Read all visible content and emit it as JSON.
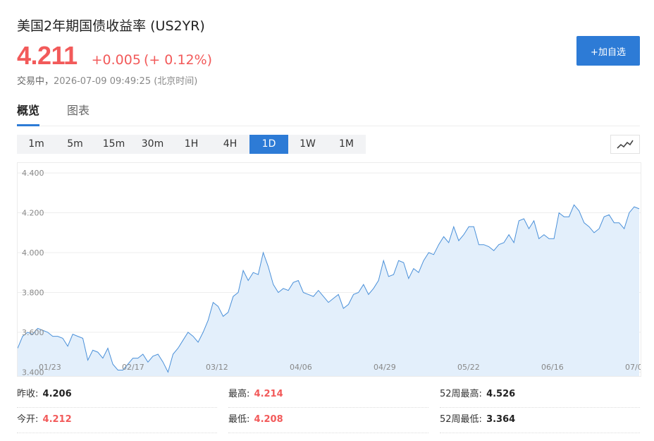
{
  "header": {
    "title": "美国2年期国债收益率",
    "code": "(US2YR)",
    "price": "4.211",
    "change": "+0.005",
    "change_pct": "(+ 0.12%)",
    "status": "交易中，",
    "timestamp": "2026-07-09 09:49:25 (北京时间)",
    "add_watchlist_label": "+加自选"
  },
  "tabs": [
    {
      "label": "概览",
      "active": true
    },
    {
      "label": "图表",
      "active": false
    }
  ],
  "ranges": [
    {
      "label": "1m",
      "active": false
    },
    {
      "label": "5m",
      "active": false
    },
    {
      "label": "15m",
      "active": false
    },
    {
      "label": "30m",
      "active": false
    },
    {
      "label": "1H",
      "active": false
    },
    {
      "label": "4H",
      "active": false
    },
    {
      "label": "1D",
      "active": true
    },
    {
      "label": "1W",
      "active": false
    },
    {
      "label": "1M",
      "active": false
    }
  ],
  "chart_type_icon": "line-chart-icon",
  "colors": {
    "accent": "#2d7bd6",
    "up": "#f25a5a",
    "line": "#4a90d9",
    "area": "#e3effb"
  },
  "chart_data": {
    "type": "area",
    "title": "",
    "xlabel": "",
    "ylabel": "",
    "ylim": [
      3.38,
      4.45
    ],
    "yticks": [
      "3.400",
      "3.600",
      "3.800",
      "4.000",
      "4.200",
      "4.400"
    ],
    "xticks": [
      "01/23",
      "02/17",
      "03/12",
      "04/06",
      "04/29",
      "05/22",
      "06/16",
      "07/0"
    ],
    "grid": true,
    "series": [
      {
        "values": [
          3.52,
          3.58,
          3.6,
          3.59,
          3.62,
          3.61,
          3.6,
          3.58,
          3.58,
          3.57,
          3.53,
          3.59,
          3.58,
          3.57,
          3.46,
          3.51,
          3.5,
          3.47,
          3.52,
          3.44,
          3.41,
          3.41,
          3.44,
          3.47,
          3.47,
          3.49,
          3.45,
          3.48,
          3.49,
          3.45,
          3.4,
          3.49,
          3.52,
          3.56,
          3.6,
          3.58,
          3.55,
          3.6,
          3.66,
          3.75,
          3.73,
          3.68,
          3.7,
          3.78,
          3.8,
          3.91,
          3.86,
          3.9,
          3.89,
          4.0,
          3.93,
          3.84,
          3.8,
          3.82,
          3.81,
          3.85,
          3.86,
          3.8,
          3.79,
          3.78,
          3.81,
          3.78,
          3.75,
          3.77,
          3.79,
          3.72,
          3.74,
          3.79,
          3.8,
          3.84,
          3.79,
          3.82,
          3.86,
          3.96,
          3.88,
          3.89,
          3.96,
          3.95,
          3.87,
          3.92,
          3.9,
          3.96,
          4.0,
          3.99,
          4.04,
          4.08,
          4.05,
          4.13,
          4.06,
          4.09,
          4.13,
          4.13,
          4.04,
          4.04,
          4.03,
          4.01,
          4.04,
          4.05,
          4.09,
          4.05,
          4.16,
          4.17,
          4.12,
          4.16,
          4.07,
          4.09,
          4.07,
          4.07,
          4.2,
          4.18,
          4.18,
          4.24,
          4.21,
          4.15,
          4.13,
          4.1,
          4.12,
          4.18,
          4.19,
          4.15,
          4.15,
          4.12,
          4.2,
          4.23,
          4.22
        ]
      }
    ]
  },
  "stats": [
    {
      "label": "昨收:",
      "value": "4.206",
      "red": false
    },
    {
      "label": "最高:",
      "value": "4.214",
      "red": true
    },
    {
      "label": "52周最高:",
      "value": "4.526",
      "red": false
    },
    {
      "label": "今开:",
      "value": "4.212",
      "red": true
    },
    {
      "label": "最低:",
      "value": "4.208",
      "red": true
    },
    {
      "label": "52周最低:",
      "value": "3.364",
      "red": false
    }
  ]
}
